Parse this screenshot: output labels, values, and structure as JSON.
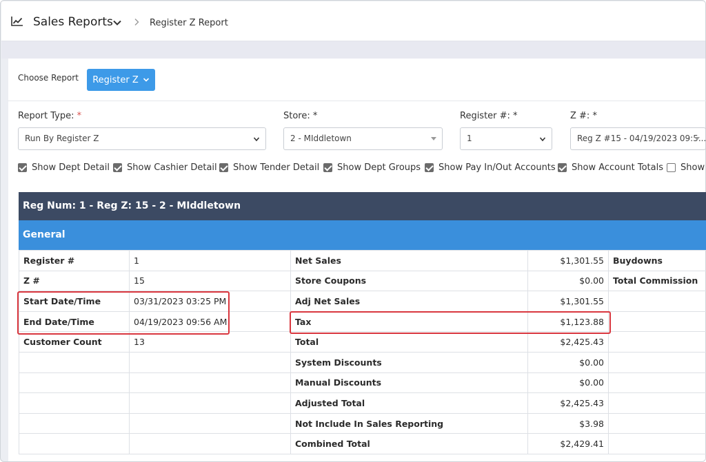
{
  "header": {
    "title": "Sales Reports",
    "breadcrumb": "Register Z Report",
    "icons": [
      "line-chart-icon",
      "chevron-down-icon",
      "chevron-right-icon"
    ]
  },
  "chooser": {
    "label": "Choose Report",
    "button_label": "Register Z"
  },
  "filters": {
    "report_type": {
      "label": "Report Type:",
      "required_mark": "*",
      "value": "Run By Register Z"
    },
    "store": {
      "label": "Store: *",
      "value": "2 - MIddletown"
    },
    "register": {
      "label": "Register #: *",
      "value": "1"
    },
    "z_number": {
      "label": "Z #: *",
      "value": "Reg Z #15 - 04/19/2023 09:5..."
    }
  },
  "options": [
    {
      "label": "Show Dept Detail",
      "checked": true
    },
    {
      "label": "Show Cashier Detail",
      "checked": true
    },
    {
      "label": "Show Tender Detail",
      "checked": true
    },
    {
      "label": "Show Dept Groups",
      "checked": true
    },
    {
      "label": "Show Pay In/Out Accounts",
      "checked": true
    },
    {
      "label": "Show Account Totals",
      "checked": true
    },
    {
      "label": "Show",
      "checked": false
    }
  ],
  "report": {
    "heading": "Reg Num: 1 - Reg Z: 15 - 2 - MIddletown",
    "section": "General",
    "rows": [
      {
        "label1": "Register #",
        "value1": "1",
        "label2": "Net Sales",
        "value2": "$1,301.55",
        "label3": "Buydowns"
      },
      {
        "label1": "Z #",
        "value1": "15",
        "label2": "Store Coupons",
        "value2": "$0.00",
        "label3": "Total Commission"
      },
      {
        "label1": "Start Date/Time",
        "value1": "03/31/2023 03:25 PM",
        "label2": "Adj Net Sales",
        "value2": "$1,301.55",
        "label3": ""
      },
      {
        "label1": "End Date/Time",
        "value1": "04/19/2023 09:56 AM",
        "label2": "Tax",
        "value2": "$1,123.88",
        "label3": ""
      },
      {
        "label1": "Customer Count",
        "value1": "13",
        "label2": "Total",
        "value2": "$2,425.43",
        "label3": ""
      },
      {
        "label1": "",
        "value1": "",
        "label2": "System Discounts",
        "value2": "$0.00",
        "label3": ""
      },
      {
        "label1": "",
        "value1": "",
        "label2": "Manual Discounts",
        "value2": "$0.00",
        "label3": ""
      },
      {
        "label1": "",
        "value1": "",
        "label2": "Adjusted Total",
        "value2": "$2,425.43",
        "label3": ""
      },
      {
        "label1": "",
        "value1": "",
        "label2": "Not Include In Sales Reporting",
        "value2": "$3.98",
        "label3": ""
      },
      {
        "label1": "",
        "value1": "",
        "label2": "Combined Total",
        "value2": "$2,429.41",
        "label3": ""
      }
    ]
  },
  "colors": {
    "accent": "#3d9ae8",
    "report_header": "#3c4a63",
    "section_header": "#3a8fdc",
    "highlight": "#d9363e"
  }
}
